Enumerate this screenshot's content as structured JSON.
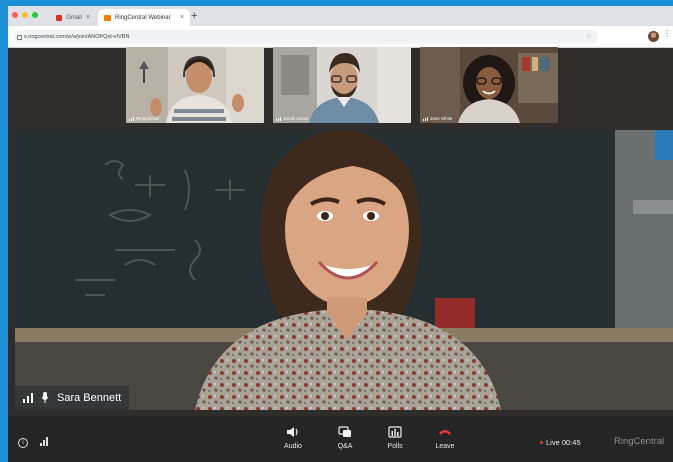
{
  "browser": {
    "tabs": [
      {
        "label": "Gmail",
        "favicon_color": "#d93025"
      },
      {
        "label": "RingCentral Webinar",
        "favicon_color": "#f57c00"
      }
    ],
    "new_tab": "+",
    "url": "s.ringcentral.com/w/a/join/ANOPQst-eIVBN",
    "menu": "⋮"
  },
  "participants": [
    {
      "name": "Ringcentral"
    },
    {
      "name": "Jacob Jones"
    },
    {
      "name": "Jane White"
    }
  ],
  "main_speaker": {
    "name": "Sara Bennett"
  },
  "toolbar": {
    "info": "i",
    "buttons": [
      {
        "label": "Audio"
      },
      {
        "label": "Q&A"
      },
      {
        "label": "Polls"
      },
      {
        "label": "Leave"
      }
    ],
    "live_label": "Live 00:45",
    "brand": "RingCentral"
  },
  "colors": {
    "accent_blue": "#1a8fd6",
    "toolbar_bg": "#252526",
    "leave_red": "#e53935",
    "live_dot": "#e53935"
  }
}
